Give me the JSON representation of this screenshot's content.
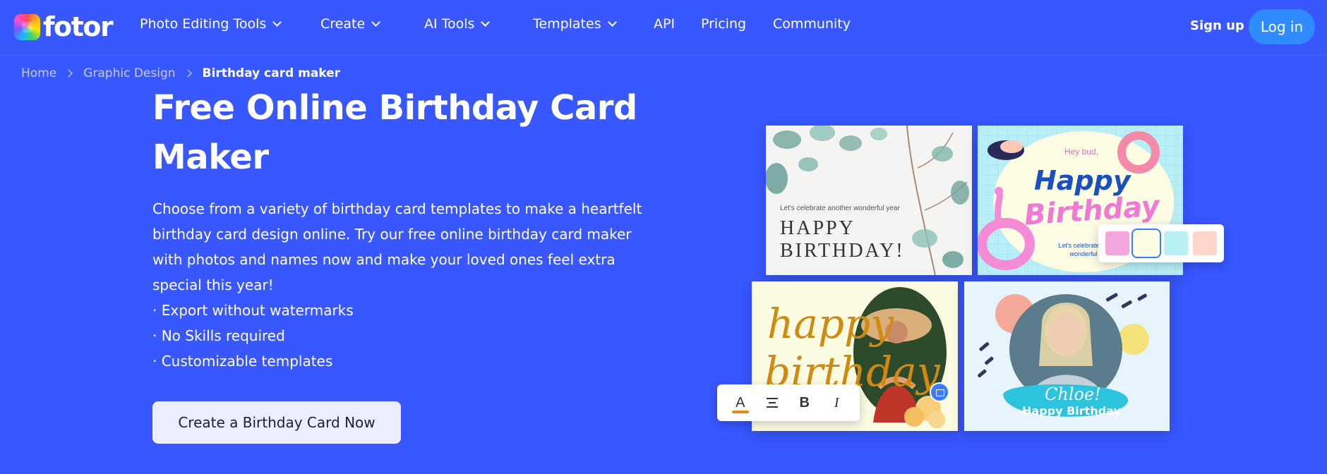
{
  "nav": {
    "logo_text": "fotor",
    "items": [
      {
        "label": "Photo Editing Tools",
        "dropdown": true
      },
      {
        "label": "Create",
        "dropdown": true
      },
      {
        "label": "AI Tools",
        "dropdown": true
      },
      {
        "label": "Templates",
        "dropdown": true
      },
      {
        "label": "API",
        "dropdown": false
      },
      {
        "label": "Pricing",
        "dropdown": false
      },
      {
        "label": "Community",
        "dropdown": false
      }
    ],
    "signup_label": "Sign up",
    "login_label": "Log in"
  },
  "breadcrumb": {
    "items": [
      "Home",
      "Graphic Design",
      "Birthday card maker"
    ]
  },
  "hero": {
    "title": "Free Online Birthday Card Maker",
    "description": "Choose from a variety of birthday card templates to make a heartfelt birthday card design online. Try our free online birthday card maker with photos and names now and make your loved ones feel extra special this year!",
    "bullets": [
      "· Export without watermarks",
      "· No Skills required",
      "· Customizable templates"
    ],
    "cta_label": "Create a Birthday Card Now"
  },
  "cards": {
    "card1": {
      "small": "Let's celebrate another wonderful year",
      "big": "HAPPY BIRTHDAY!"
    },
    "card2": {
      "hey": "Hey bud,",
      "happy": "Happy",
      "birthday": "Birthday",
      "sub": "Let's celebrate another wonderful year"
    },
    "card3": {
      "happy": "happy",
      "birthday": "birthday"
    },
    "card4": {
      "name": "Chloe!",
      "hb": "Happy Birthday"
    }
  },
  "swatches": [
    "#f4a6dc",
    "#fdfde4",
    "#b8f0f4",
    "#ffd6cc"
  ],
  "toolbar": {
    "a": "A",
    "bold": "B",
    "italic": "I"
  },
  "colors": {
    "background": "#3857ff",
    "login": "#2e8cff",
    "cta_bg": "#ebeeff"
  }
}
